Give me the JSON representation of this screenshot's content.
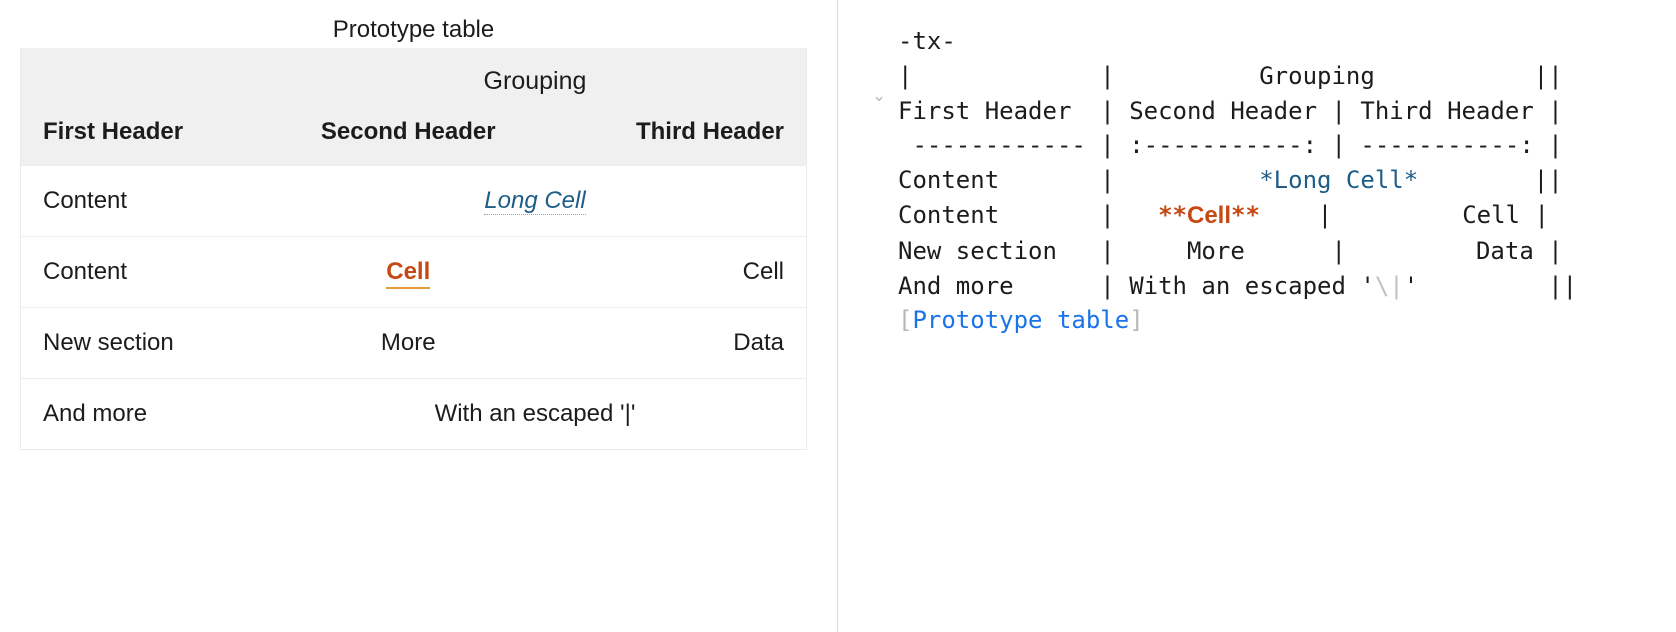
{
  "rendered": {
    "caption": "Prototype table",
    "group_header": "Grouping",
    "headers": {
      "h1": "First Header",
      "h2": "Second Header",
      "h3": "Third Header"
    },
    "rows": {
      "r1": {
        "c1": "Content",
        "long": "Long Cell"
      },
      "r2": {
        "c1": "Content",
        "c2": "Cell",
        "c3": "Cell"
      },
      "r3": {
        "c1": "New section",
        "c2": "More",
        "c3": "Data"
      },
      "r4": {
        "c1": "And more",
        "esc": "With an escaped '|'"
      }
    }
  },
  "source": {
    "l1": "-tx-",
    "l2": "|             |          Grouping           ||",
    "l3": "First Header  | Second Header | Third Header |",
    "l4": " ------------ | :-----------: | -----------: |",
    "l5a": "Content       |          ",
    "l5b": "*Long Cell*",
    "l5c": "        ||",
    "l6a": "Content       |   ",
    "l6b_marks": "**",
    "l6b_inner": "Cell",
    "l6c": "    |         Cell |",
    "l7": "New section   |     More      |         Data |",
    "l8a": "And more      | With an escaped '",
    "l8b": "\\|",
    "l8c": "'         ||",
    "l9a": "[",
    "l9b": "Prototype table",
    "l9c": "]"
  }
}
